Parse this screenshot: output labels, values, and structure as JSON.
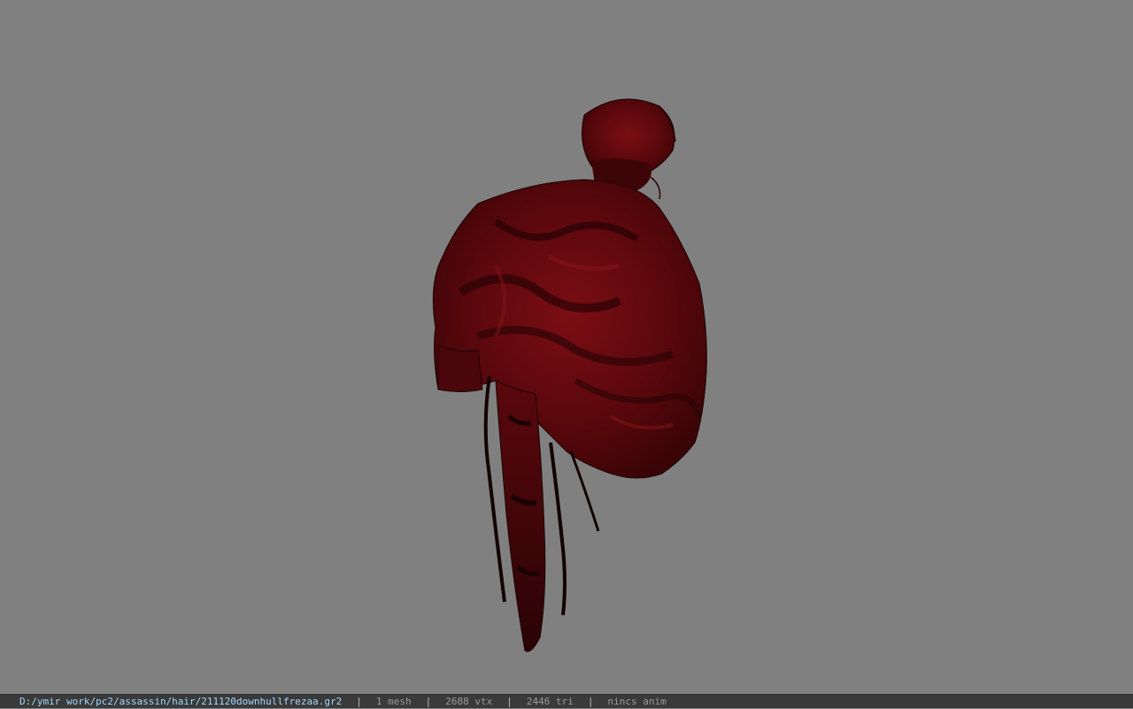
{
  "viewport": {
    "background_color": "#808080",
    "model": {
      "name": "hair-mesh",
      "primary_color": "#6a0a0e",
      "shadow_color": "#1e0204",
      "highlight_color": "#8a141a"
    }
  },
  "statusbar": {
    "file_path": "D:/ymir work/pc2/assassin/hair/211120downhullfrezaa.gr2",
    "separator": "|",
    "mesh_count": "1 mesh",
    "vertex_count": "2688 vtx",
    "triangle_count": "2446 tri",
    "anim_status": "nincs anim",
    "path_color": "#9fd7ff"
  }
}
